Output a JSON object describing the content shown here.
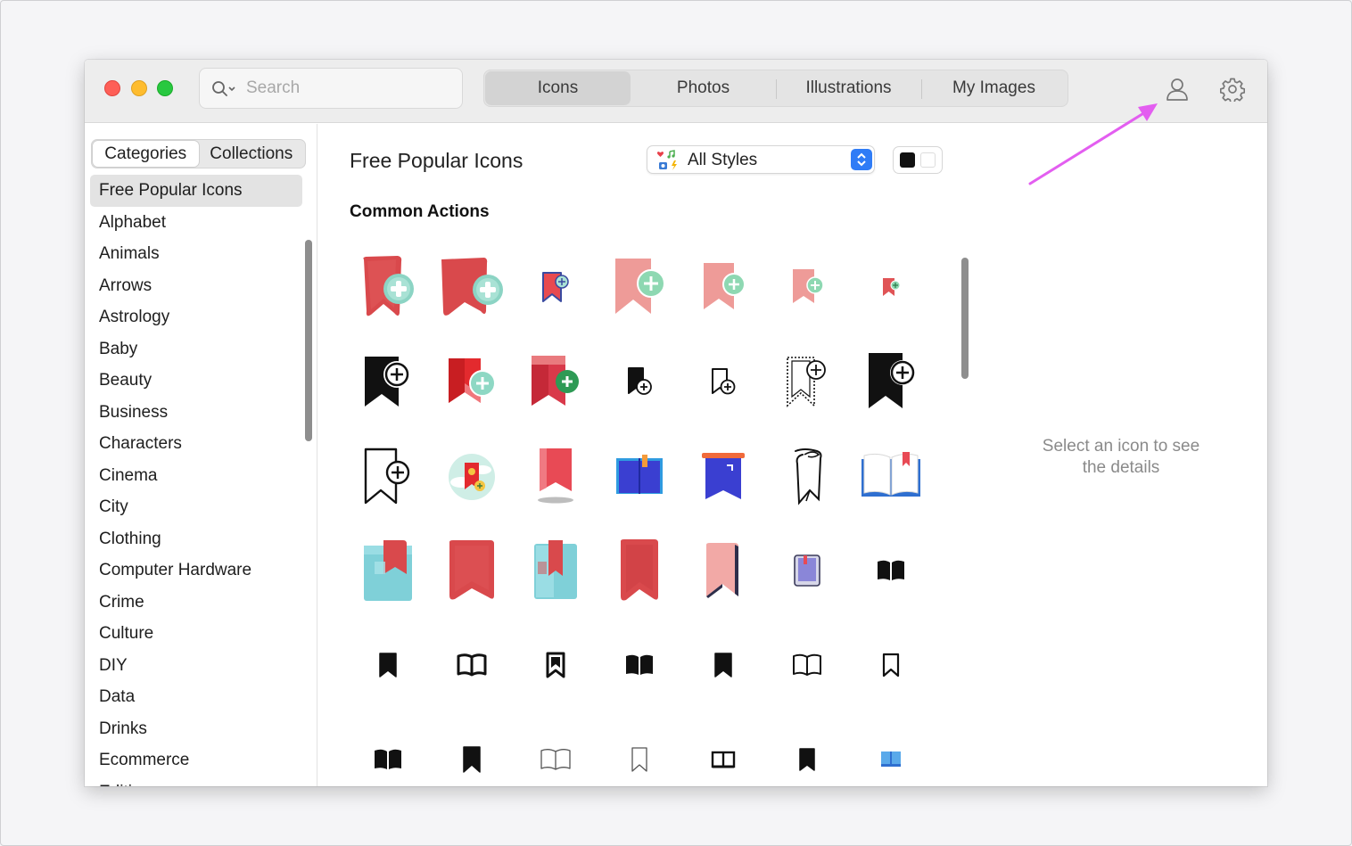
{
  "search": {
    "placeholder": "Search"
  },
  "top_tabs": [
    "Icons",
    "Photos",
    "Illustrations",
    "My Images"
  ],
  "active_tab": "Icons",
  "sidebar": {
    "segments": [
      "Categories",
      "Collections"
    ],
    "active_segment": "Categories",
    "categories": [
      "Free Popular Icons",
      "Alphabet",
      "Animals",
      "Arrows",
      "Astrology",
      "Baby",
      "Beauty",
      "Business",
      "Characters",
      "Cinema",
      "City",
      "Clothing",
      "Computer Hardware",
      "Crime",
      "Culture",
      "DIY",
      "Data",
      "Drinks",
      "Ecommerce",
      "Editing"
    ],
    "selected": "Free Popular Icons"
  },
  "main": {
    "title": "Free Popular Icons",
    "style_filter": "All Styles",
    "section_title": "Common Actions"
  },
  "icon_grid": [
    [
      "bookmark-plus-3d-icon",
      "bookmark-plus-3d-icon",
      "bookmark-plus-small-icon",
      "bookmark-plus-pink-icon",
      "bookmark-plus-pink-icon",
      "bookmark-plus-pink-icon",
      "bookmark-plus-tiny-icon"
    ],
    [
      "bookmark-plus-black-icon",
      "bookmark-plus-red-icon",
      "bookmark-plus-red-green-icon",
      "bookmark-plus-solid-small-icon",
      "bookmark-plus-outline-small-icon",
      "bookmark-plus-dotted-icon",
      "bookmark-plus-black-icon"
    ],
    [
      "bookmark-plus-outline-icon",
      "bookmark-cloud-icon",
      "bookmark-red-icon",
      "book-blue-icon",
      "bookmark-blue-icon",
      "bookmark-sketch-icon",
      "open-book-icon"
    ],
    [
      "book-teal-3d-icon",
      "bookmark-3d-icon",
      "book-teal-3d-icon",
      "bookmark-3d-icon",
      "bookmark-pink-icon",
      "book-purple-icon",
      "open-book-solid-icon"
    ],
    [
      "bookmark-solid-icon",
      "open-book-outline-icon",
      "bookmark-outline-bold-icon",
      "open-book-solid-icon",
      "bookmark-solid-icon",
      "open-book-outline-icon",
      "bookmark-outline-icon"
    ],
    [
      "open-book-solid-icon",
      "bookmark-solid-icon",
      "open-book-thin-icon",
      "bookmark-thin-icon",
      "open-book-line-icon",
      "bookmark-solid-icon",
      "book-blue-small-icon"
    ]
  ],
  "detail": {
    "empty_line1": "Select an icon to see",
    "empty_line2": "the details"
  },
  "colors": {
    "accent": "#2f7cf6",
    "annotation_arrow": "#e35ef0",
    "bookmark_red": "#e84a4f",
    "bookmark_pink": "#ee9b98",
    "plus_green": "#8ed8b2"
  }
}
